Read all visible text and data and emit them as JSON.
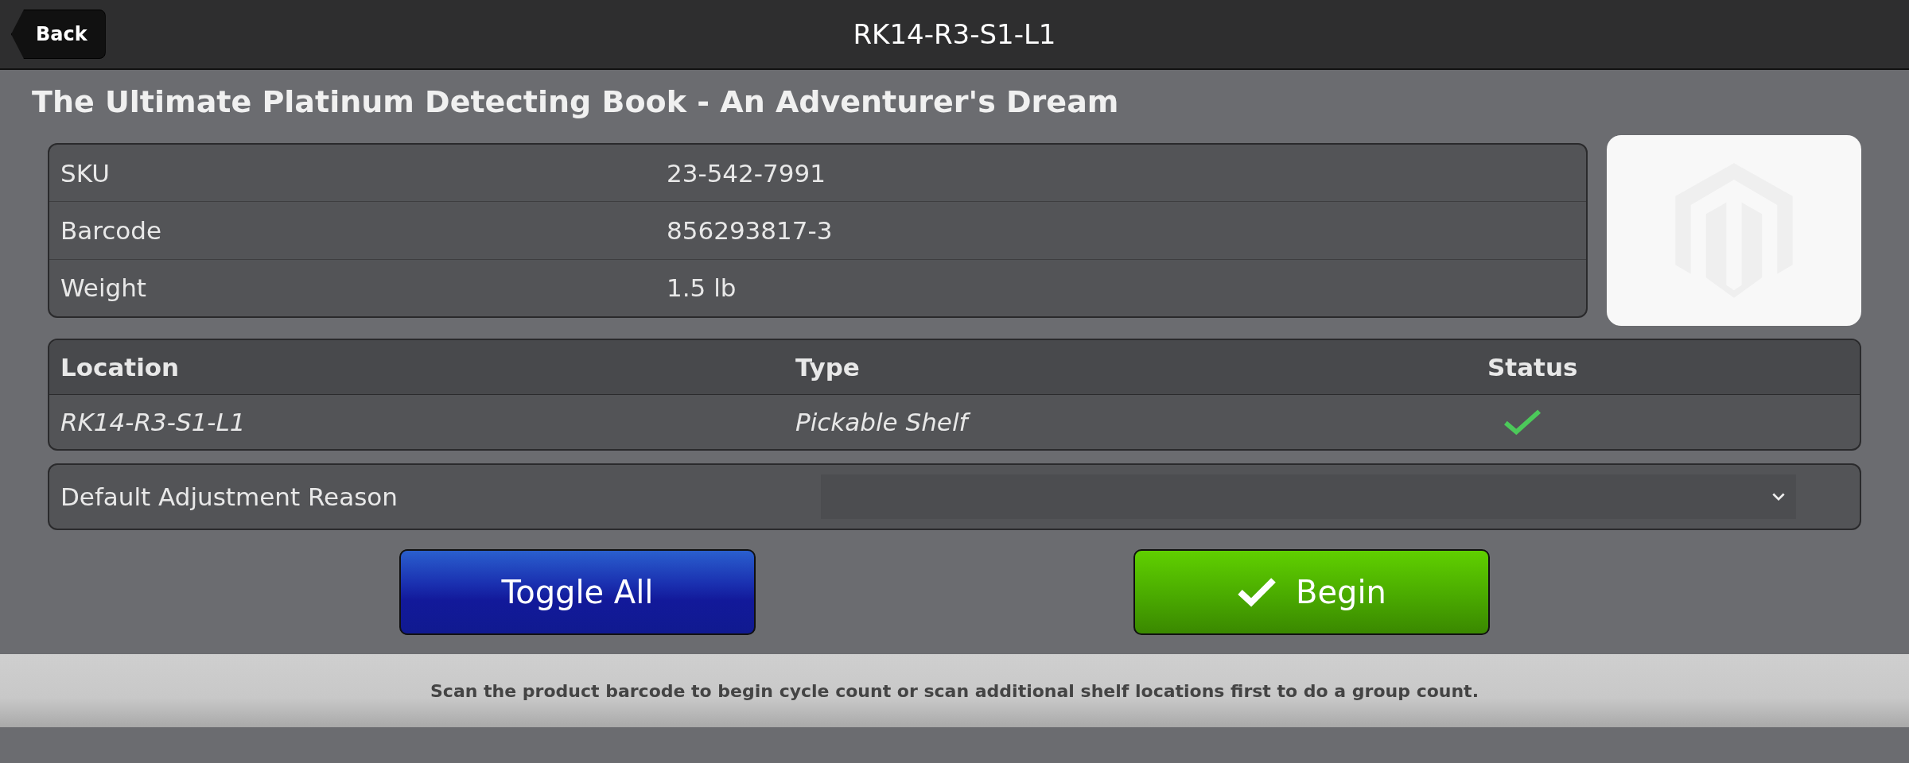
{
  "header": {
    "back_label": "Back",
    "title": "RK14-R3-S1-L1"
  },
  "product": {
    "name": "The Ultimate Platinum Detecting Book - An Adventurer's Dream",
    "details": [
      {
        "label": "SKU",
        "value": "23-542-7991"
      },
      {
        "label": "Barcode",
        "value": "856293817-3"
      },
      {
        "label": "Weight",
        "value": "1.5 lb"
      }
    ],
    "image": {
      "kind": "placeholder"
    }
  },
  "locations": {
    "columns": [
      "Location",
      "Type",
      "Status"
    ],
    "rows": [
      {
        "location": "RK14-R3-S1-L1",
        "type": "Pickable Shelf",
        "checked": true
      }
    ]
  },
  "adjustment": {
    "label": "Default Adjustment Reason"
  },
  "buttons": [
    {
      "label": "Toggle All",
      "kind": "toggle"
    },
    {
      "label": "Begin",
      "kind": "begin"
    }
  ],
  "footer": {
    "message": "Scan the product barcode to begin cycle count or scan additional shelf locations first to do a group count."
  }
}
